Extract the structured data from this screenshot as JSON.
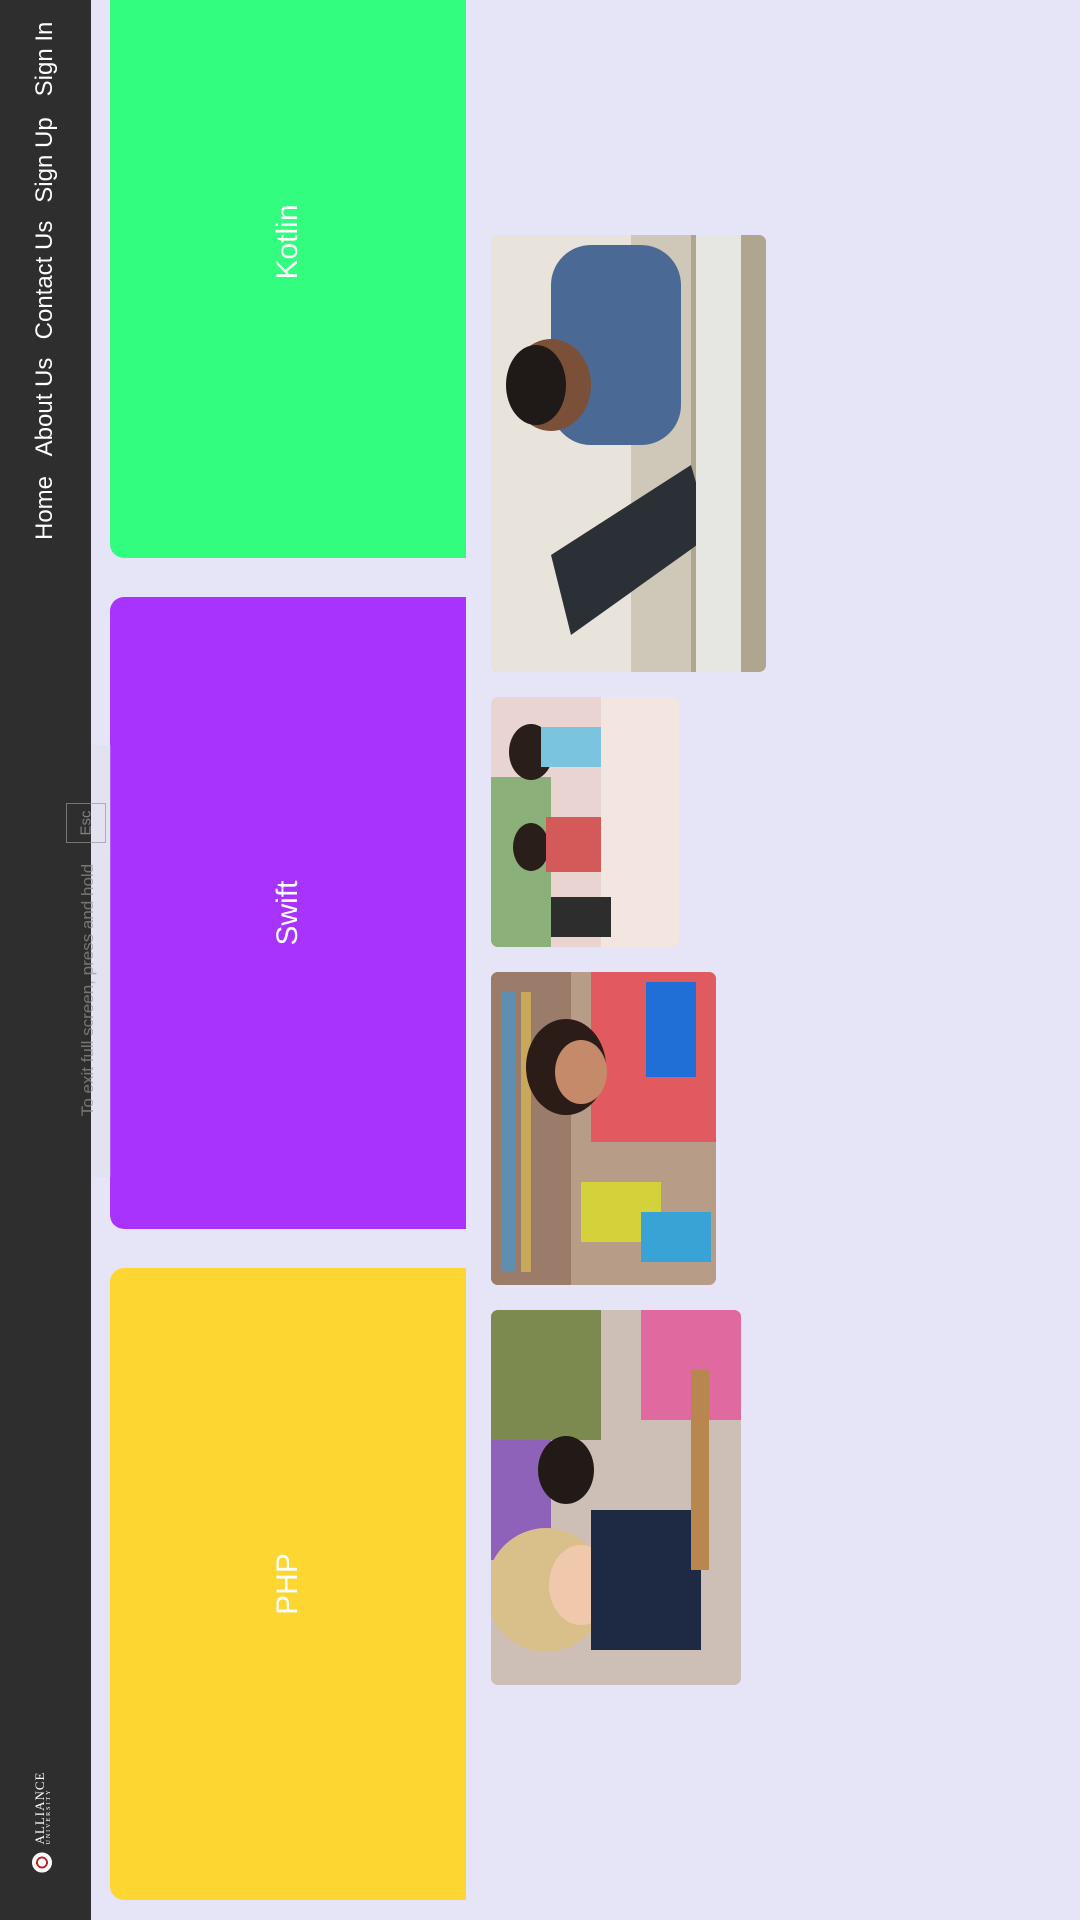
{
  "nav": {
    "items": [
      {
        "label": "Home"
      },
      {
        "label": "About Us"
      },
      {
        "label": "Contact Us"
      },
      {
        "label": "Sign Up"
      },
      {
        "label": "Sign In"
      }
    ],
    "logo": {
      "line1": "ALLIANCE",
      "line2": "UNIVERSITY",
      "icon": "university-seal-icon"
    }
  },
  "courses": [
    {
      "label": "Kotlin",
      "color": "#33fd7f"
    },
    {
      "label": "Swift",
      "color": "#a733fd"
    },
    {
      "label": "PHP",
      "color": "#fed631"
    }
  ],
  "fullscreen_hint": {
    "text": "To exit full screen, press and hold",
    "key": "Esc"
  },
  "photos": [
    {
      "name": "photo-student-laptop"
    },
    {
      "name": "photo-classroom-students"
    },
    {
      "name": "photo-student-library"
    },
    {
      "name": "photo-students-desk"
    }
  ]
}
